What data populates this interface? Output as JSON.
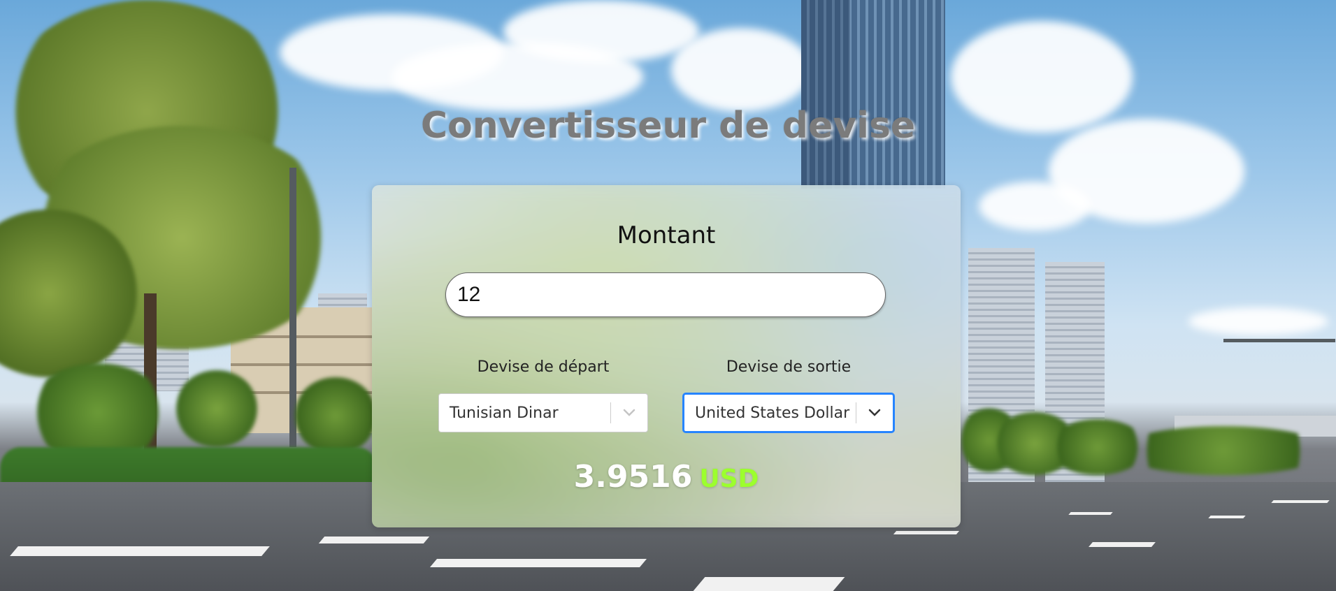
{
  "page": {
    "title": "Convertisseur de devise"
  },
  "form": {
    "amount_label": "Montant",
    "amount_value": "12",
    "from_label": "Devise de départ",
    "to_label": "Devise de sortie",
    "from_currency": "Tunisian Dinar",
    "to_currency": "United States Dollar"
  },
  "result": {
    "value": "3.9516",
    "currency": "USD"
  },
  "colors": {
    "title": "#7b7b7b",
    "result_value": "#ffffff",
    "result_currency": "#9cff2e",
    "focus_border": "#2684ff"
  },
  "icons": {
    "from_dropdown": "chevron-down-icon",
    "to_dropdown": "chevron-down-icon"
  }
}
